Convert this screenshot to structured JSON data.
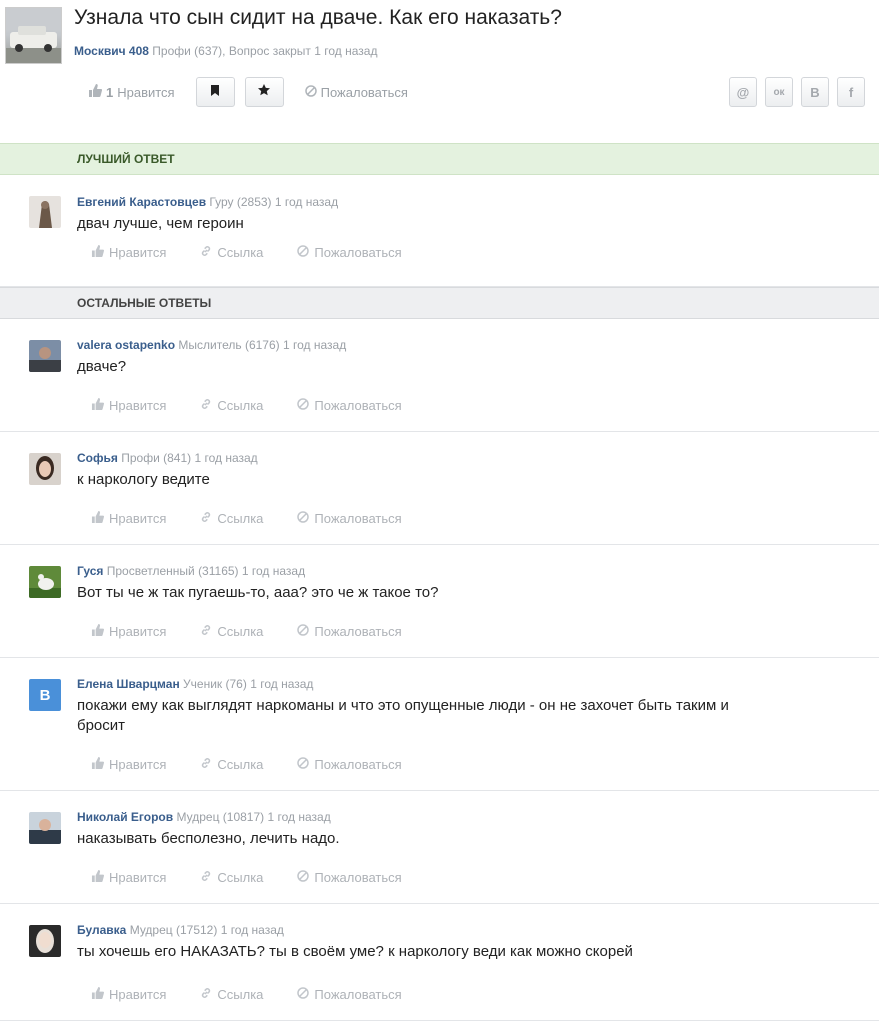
{
  "question": {
    "title": "Узнала что сын сидит на дваче. Как его наказать?",
    "author": "Москвич 408",
    "author_meta": "Профи (637), Вопрос закрыт 1 год назад",
    "like_count": "1",
    "like_label": "Нравится",
    "report_label": "Пожаловаться",
    "share_icons": [
      "@",
      "ок",
      "B",
      "f"
    ]
  },
  "sections": {
    "best": "ЛУЧШИЙ ОТВЕТ",
    "others": "ОСТАЛЬНЫЕ ОТВЕТЫ"
  },
  "actions": {
    "like": "Нравится",
    "link": "Ссылка",
    "report": "Пожаловаться"
  },
  "best_answer": {
    "name": "Евгений Карастовцев",
    "meta": "Гуру (2853)",
    "time": "1 год назад",
    "text": "двач лучше, чем героин"
  },
  "answers": [
    {
      "name": "valera ostapenko",
      "meta": "Мыслитель (6176)",
      "time": "1 год назад",
      "text": "дваче?"
    },
    {
      "name": "Софья",
      "meta": "Профи (841)",
      "time": "1 год назад",
      "text": "к наркологу ведите"
    },
    {
      "name": "Гуся",
      "meta": "Просветленный (31165)",
      "time": "1 год назад",
      "text": "Вот ты че ж так пугаешь-то, ааа? это че ж такое то?"
    },
    {
      "name": "Елена Шварцман",
      "meta": "Ученик (76)",
      "time": "1 год назад",
      "text": "покажи ему как выглядят наркоманы и что это опущенные люди - он не захочет быть таким и бросит",
      "avatar_letter": "B"
    },
    {
      "name": "Николай Егоров",
      "meta": "Мудрец (10817)",
      "time": "1 год назад",
      "text": "наказывать бесполезно, лечить надо."
    },
    {
      "name": "Булавка",
      "meta": "Мудрец (17512)",
      "time": "1 год назад",
      "text": "ты хочешь его НАКАЗАТЬ? ты в своём уме? к наркологу веди как можно скорей"
    }
  ]
}
